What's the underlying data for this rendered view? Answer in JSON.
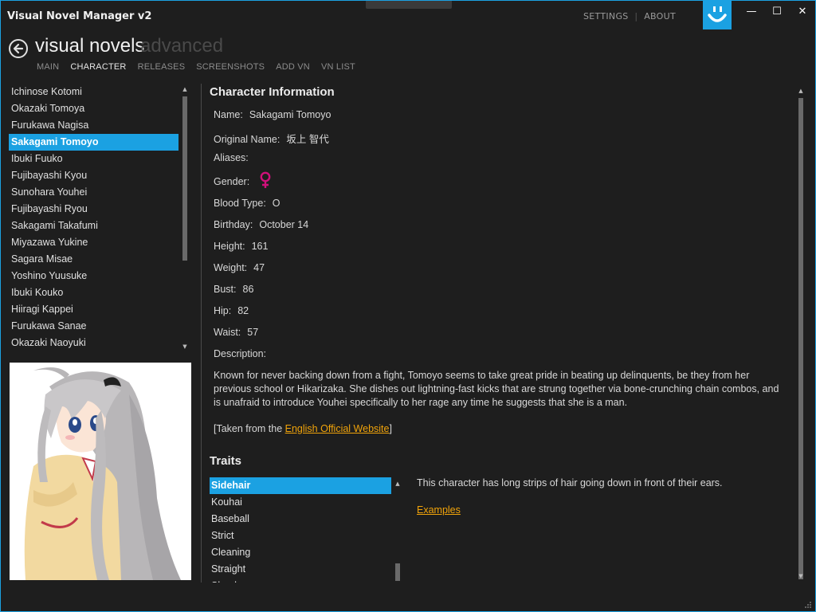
{
  "window": {
    "title": "Visual Novel Manager v2",
    "settings_label": "SETTINGS",
    "about_label": "ABOUT",
    "separator": "|",
    "minimize": "—",
    "maximize": "☐",
    "close": "✕",
    "accent_color": "#1ba1e2"
  },
  "header": {
    "title": "visual novels",
    "subtitle": "advanced",
    "nav": [
      "MAIN",
      "CHARACTER",
      "RELEASES",
      "SCREENSHOTS",
      "ADD VN",
      "VN LIST"
    ],
    "active_nav": "CHARACTER"
  },
  "characters": {
    "items": [
      "Ichinose Kotomi",
      "Okazaki Tomoya",
      "Furukawa Nagisa",
      "Sakagami Tomoyo",
      "Ibuki Fuuko",
      "Fujibayashi Kyou",
      "Sunohara Youhei",
      "Fujibayashi Ryou",
      "Sakagami Takafumi",
      "Miyazawa Yukine",
      "Sagara Misae",
      "Yoshino Yuusuke",
      "Ibuki Kouko",
      "Hiiragi Kappei",
      "Furukawa Sanae",
      "Okazaki Naoyuki"
    ],
    "selected_index": 3
  },
  "info": {
    "section_title": "Character Information",
    "name_label": "Name:",
    "name_value": "Sakagami Tomoyo",
    "original_label": "Original Name:",
    "original_value": "坂上 智代",
    "aliases_label": "Aliases:",
    "aliases_value": "",
    "gender_label": "Gender:",
    "gender_icon": "female-symbol-icon",
    "gender_color": "#d0107a",
    "blood_label": "Blood Type:",
    "blood_value": "O",
    "birthday_label": "Birthday:",
    "birthday_value": "October 14",
    "height_label": "Height:",
    "height_value": "161",
    "weight_label": "Weight:",
    "weight_value": "47",
    "bust_label": "Bust:",
    "bust_value": "86",
    "hip_label": "Hip:",
    "hip_value": "82",
    "waist_label": "Waist:",
    "waist_value": "57",
    "description_label": "Description:",
    "description": "Known for never backing down from a fight, Tomoyo seems to take great pride in beating up delinquents, be they from her previous school or Hikarizaka. She dishes out lightning-fast kicks that are strung together via bone-crunching chain combos, and is unafraid to introduce Youhei specifically to her rage any time he suggests that she is a man.",
    "source_prefix": "[Taken from the ",
    "source_link": "English Official Website",
    "source_suffix": "]",
    "link_color": "#f0a30a"
  },
  "traits": {
    "section_title": "Traits",
    "items": [
      "Sidehair",
      "Kouhai",
      "Baseball",
      "Strict",
      "Cleaning",
      "Straight",
      "Slender"
    ],
    "selected_index": 0,
    "description": "This character has long strips of hair going down in front of their ears.",
    "examples_link": "Examples"
  }
}
